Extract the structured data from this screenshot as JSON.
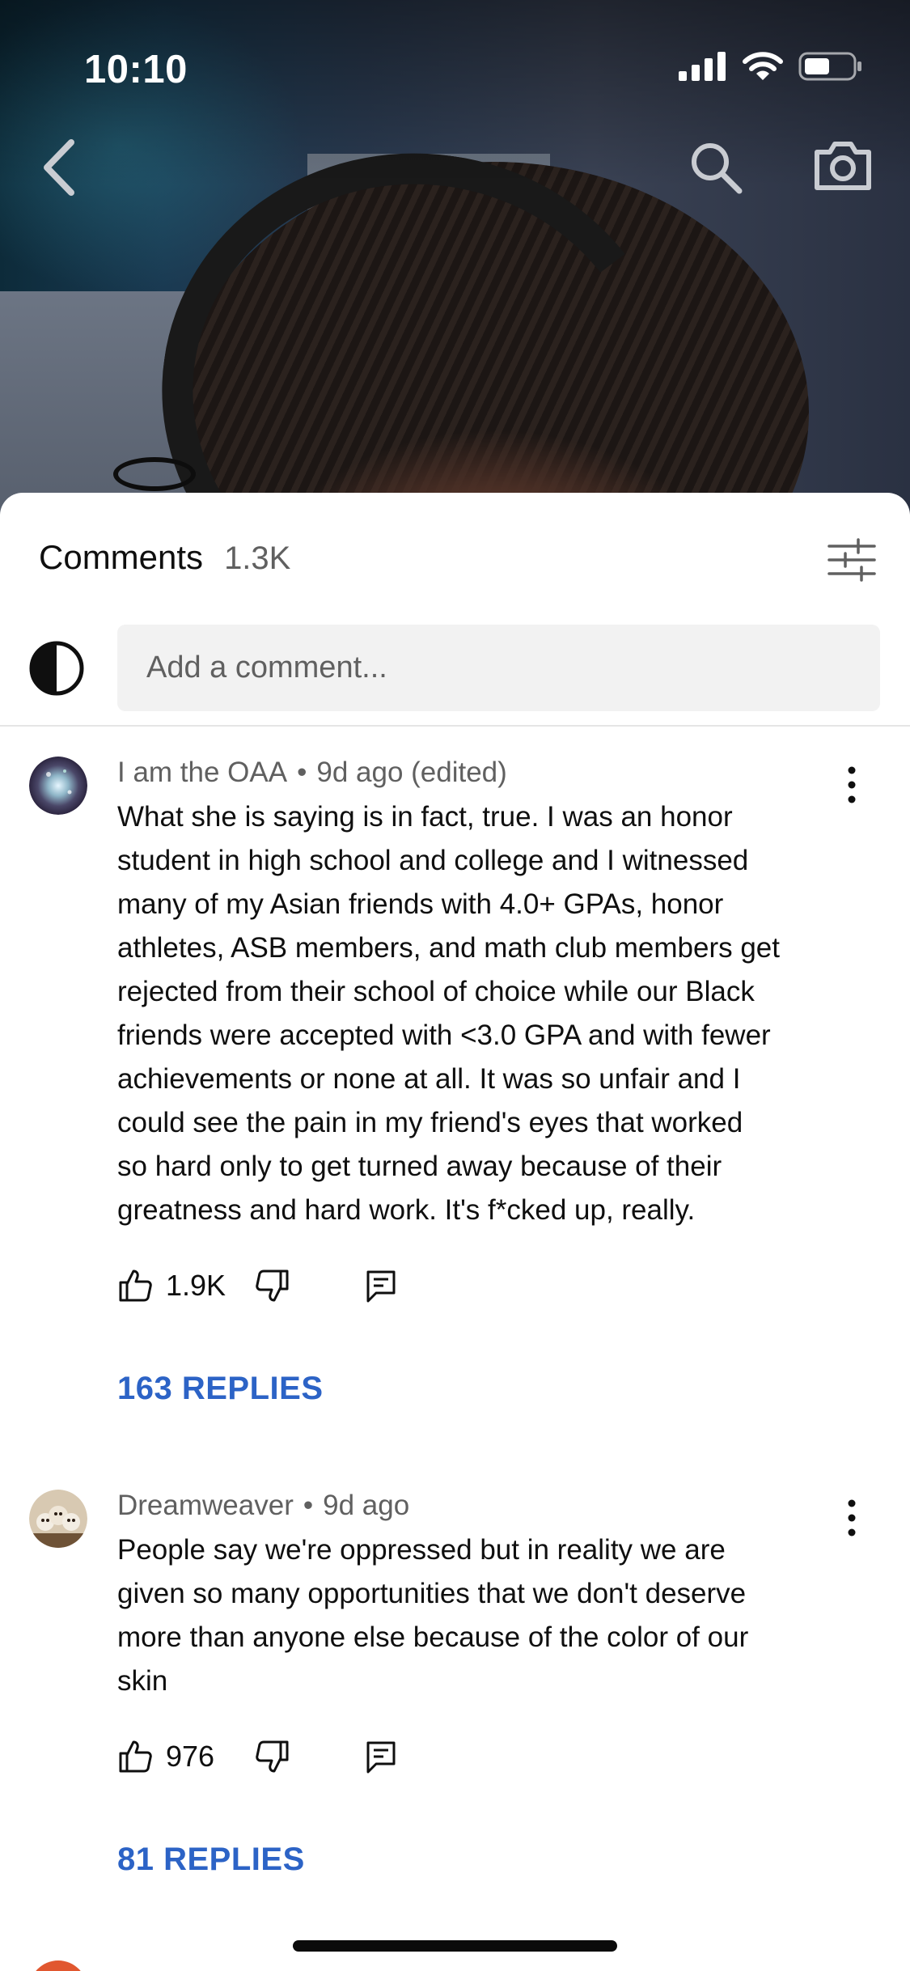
{
  "status_bar": {
    "time": "10:10"
  },
  "video": {
    "back_icon": "chevron-left-icon",
    "search_icon": "search-icon",
    "camera_icon": "camera-icon"
  },
  "comments_panel": {
    "title": "Comments",
    "count": "1.3K",
    "filter_icon": "sliders-icon",
    "add_comment_placeholder": "Add a comment..."
  },
  "comments": [
    {
      "author": "I am the OAA",
      "time": "9d ago (edited)",
      "lines": [
        "What she is saying is in fact, true. I was an honor",
        "student in high school and college and I witnessed",
        "many of my Asian friends with 4.0+ GPAs, honor",
        "athletes, ASB members, and math club members get",
        "rejected from their school of choice while our Black",
        "friends were accepted with <3.0 GPA and with fewer",
        "achievements or none at all. It was so unfair and I",
        "could see the pain in my friend's eyes that worked",
        "so hard only to get turned away because of their",
        "greatness and hard work. It's f*cked up, really."
      ],
      "likes": "1.9K",
      "replies": "163 REPLIES"
    },
    {
      "author": "Dreamweaver",
      "time": "9d ago",
      "lines": [
        "People say we're oppressed but in reality we are",
        "given so many opportunities that we don't deserve",
        "more than anyone else because of the color of our",
        "skin"
      ],
      "likes": "976",
      "replies": "81 REPLIES"
    }
  ],
  "colors": {
    "accent_link": "#2c63c6",
    "meta_text": "#606060",
    "input_bg": "#f2f2f2"
  }
}
